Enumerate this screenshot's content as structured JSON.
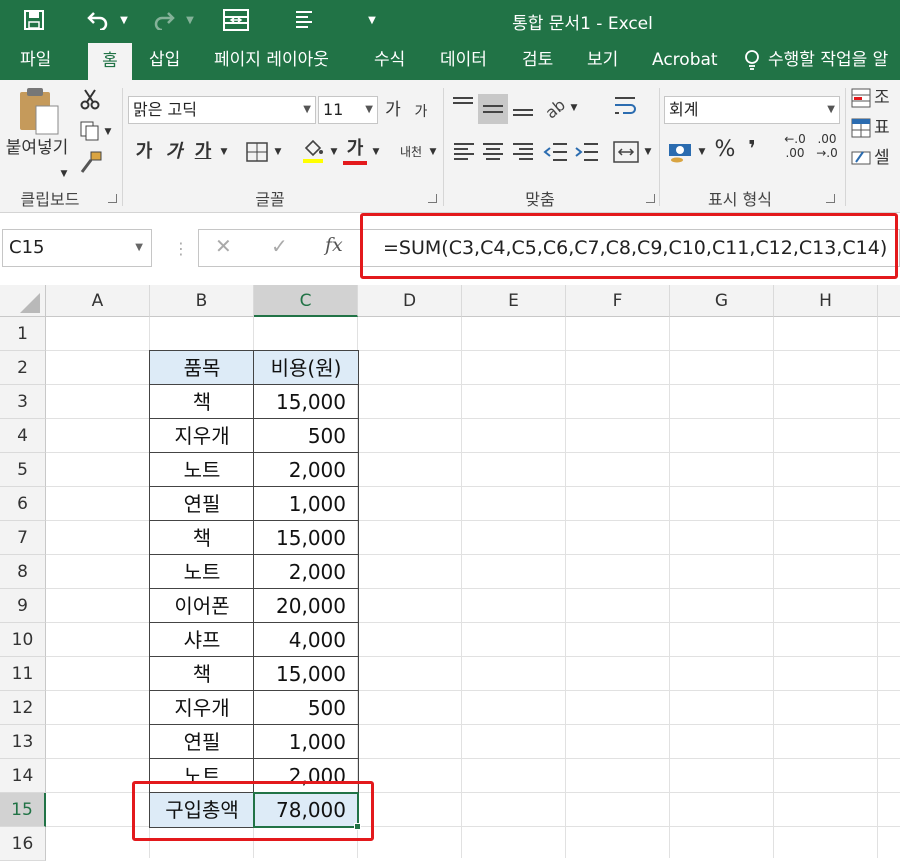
{
  "window": {
    "title": "통합 문서1 - Excel"
  },
  "qat": {
    "save_icon": "save-icon",
    "undo_icon": "undo-icon",
    "redo_icon": "redo-icon",
    "form_icon": "form-icon",
    "print_icon": "print-preview-icon",
    "customize_icon": "chevron-down-icon"
  },
  "tabs": [
    "파일",
    "홈",
    "삽입",
    "페이지 레이아웃",
    "수식",
    "데이터",
    "검토",
    "보기",
    "Acrobat",
    "수행할 작업을 알"
  ],
  "active_tab": "홈",
  "ribbon": {
    "clipboard": {
      "paste_label": "붙여넣기",
      "group_label": "클립보드"
    },
    "font": {
      "font_name": "맑은 고딕",
      "font_size": "11",
      "grow": "가",
      "shrink": "가",
      "bold": "가",
      "italic": "가",
      "underline": "가",
      "font_color_label": "가",
      "phonetic": "내천",
      "group_label": "글꼴"
    },
    "alignment": {
      "group_label": "맞춤"
    },
    "number": {
      "format": "회계",
      "percent": "%",
      "comma": "❜",
      "inc_decimal_top": "←.0",
      "inc_decimal_bottom": ".00",
      "dec_decimal_top": ".00",
      "dec_decimal_bottom": "→.0",
      "group_label": "표시 형식"
    },
    "styles": {
      "conditional": "조",
      "table": "표",
      "cell": "셀"
    }
  },
  "formula_bar": {
    "name_box": "C15",
    "cancel": "✕",
    "enter": "✓",
    "fx": "fx",
    "formula": "=SUM(C3,C4,C5,C6,C7,C8,C9,C10,C11,C12,C13,C14)"
  },
  "sheet": {
    "columns": [
      "A",
      "B",
      "C",
      "D",
      "E",
      "F",
      "G",
      "H"
    ],
    "rows": [
      "1",
      "2",
      "3",
      "4",
      "5",
      "6",
      "7",
      "8",
      "9",
      "10",
      "11",
      "12",
      "13",
      "14",
      "15",
      "16"
    ],
    "selected_cell": "C15",
    "header": {
      "item": "품목",
      "cost": "비용(원)"
    },
    "items": [
      {
        "item": "책",
        "cost": "15,000"
      },
      {
        "item": "지우개",
        "cost": "500"
      },
      {
        "item": "노트",
        "cost": "2,000"
      },
      {
        "item": "연필",
        "cost": "1,000"
      },
      {
        "item": "책",
        "cost": "15,000"
      },
      {
        "item": "노트",
        "cost": "2,000"
      },
      {
        "item": "이어폰",
        "cost": "20,000"
      },
      {
        "item": "샤프",
        "cost": "4,000"
      },
      {
        "item": "책",
        "cost": "15,000"
      },
      {
        "item": "지우개",
        "cost": "500"
      },
      {
        "item": "연필",
        "cost": "1,000"
      },
      {
        "item": "노트",
        "cost": "2,000"
      }
    ],
    "total": {
      "label": "구입총액",
      "value": "78,000"
    }
  },
  "colors": {
    "excel_green": "#217346",
    "highlight_red": "#e3191c",
    "header_fill": "#ddebf7"
  }
}
